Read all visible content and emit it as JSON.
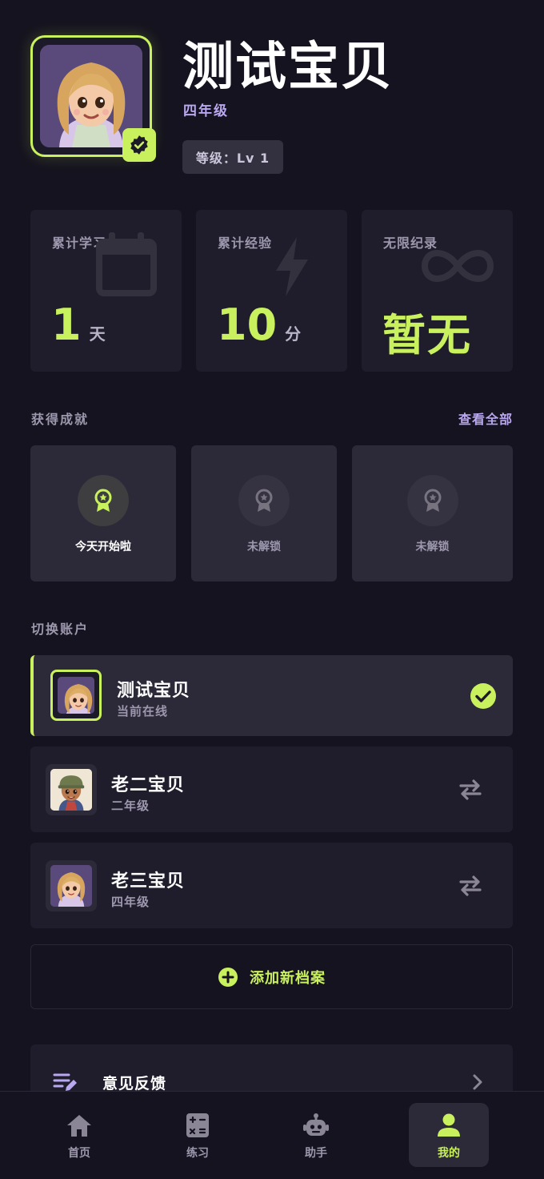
{
  "profile": {
    "name": "测试宝贝",
    "grade": "四年级",
    "level": "等级：Lv 1"
  },
  "stats": [
    {
      "label": "累计学习",
      "value": "1",
      "unit": "天",
      "icon": "calendar-icon"
    },
    {
      "label": "累计经验",
      "value": "10",
      "unit": "分",
      "icon": "bolt-icon"
    },
    {
      "label": "无限纪录",
      "value": "暂无",
      "unit": "",
      "icon": "infinity-icon"
    }
  ],
  "achievements": {
    "title": "获得成就",
    "view_all": "查看全部",
    "items": [
      {
        "label": "今天开始啦",
        "unlocked": true,
        "icon": "award-icon"
      },
      {
        "label": "未解锁",
        "unlocked": false,
        "icon": "award-icon"
      },
      {
        "label": "未解锁",
        "unlocked": false,
        "icon": "award-icon"
      }
    ]
  },
  "accounts": {
    "title": "切换账户",
    "items": [
      {
        "name": "测试宝贝",
        "sub": "当前在线",
        "active": true,
        "action_icon": "check-circle-icon"
      },
      {
        "name": "老二宝贝",
        "sub": "二年级",
        "active": false,
        "action_icon": "swap-icon"
      },
      {
        "name": "老三宝贝",
        "sub": "四年级",
        "active": false,
        "action_icon": "swap-icon"
      }
    ],
    "add_label": "添加新档案"
  },
  "menu": {
    "feedback_label": "意见反馈"
  },
  "nav": [
    {
      "label": "首页",
      "icon": "home-icon",
      "active": false
    },
    {
      "label": "练习",
      "icon": "calculator-icon",
      "active": false
    },
    {
      "label": "助手",
      "icon": "robot-icon",
      "active": false
    },
    {
      "label": "我的",
      "icon": "person-icon",
      "active": true
    }
  ],
  "colors": {
    "background": "#15131f",
    "card": "#1f1c2c",
    "accent": "#c9f05d",
    "purple": "#b9a7f0",
    "muted": "#9d98ad"
  }
}
